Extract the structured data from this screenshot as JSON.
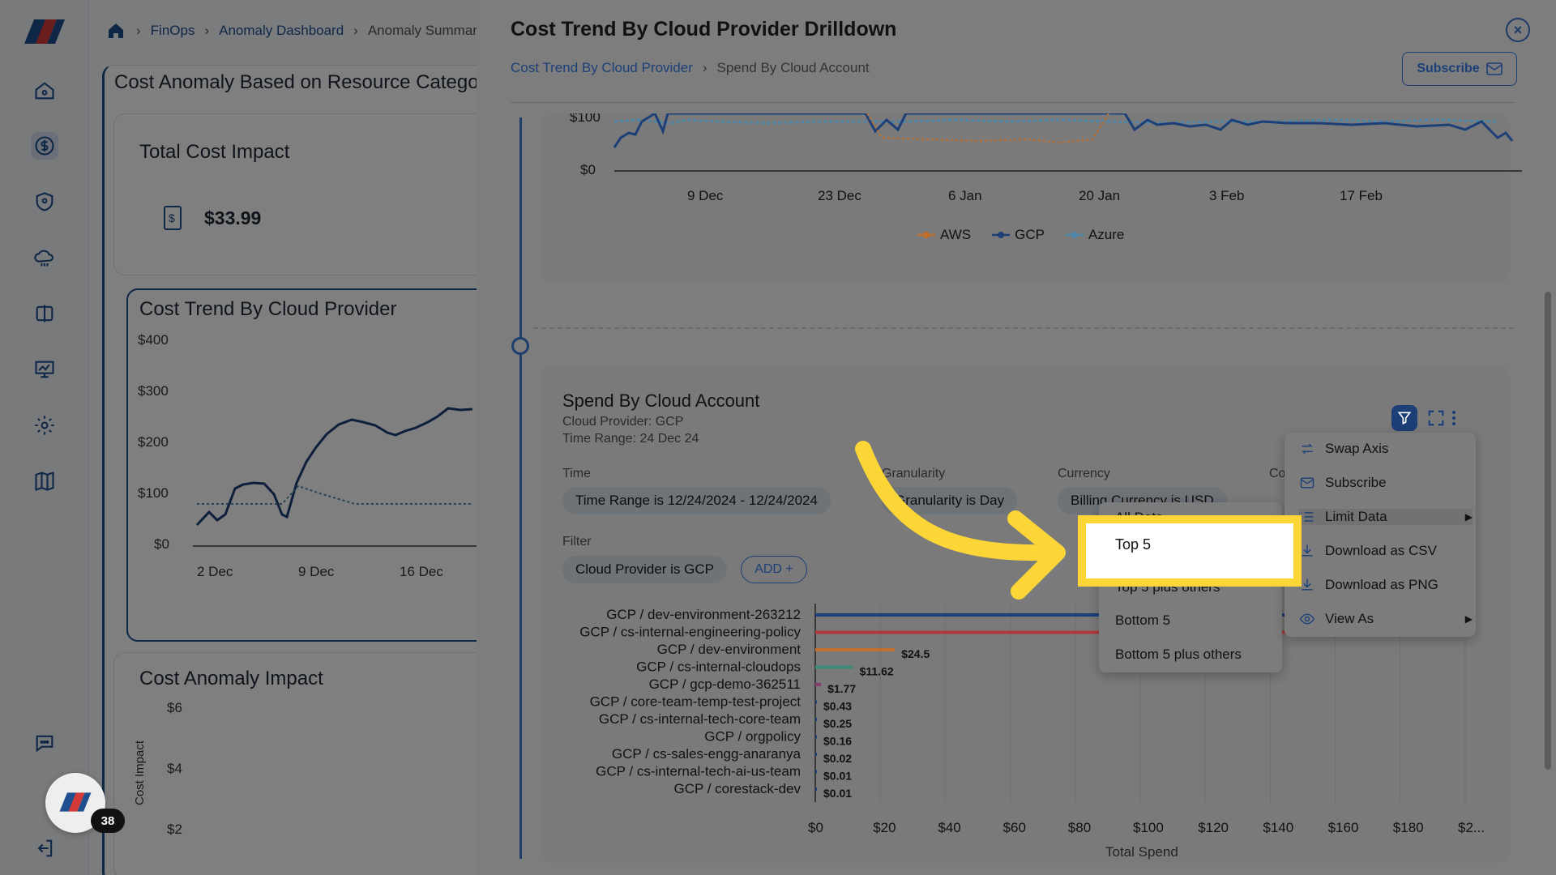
{
  "breadcrumb": {
    "items": [
      "FinOps",
      "Anomaly Dashboard"
    ],
    "current": "Anomaly Summary"
  },
  "background": {
    "section_title": "Cost Anomaly Based on Resource Catego",
    "total_cost": {
      "title": "Total Cost Impact",
      "value": "$33.99"
    },
    "trend_card": {
      "title": "Cost Trend By Cloud Provider",
      "y_ticks": [
        "$400",
        "$300",
        "$200",
        "$100",
        "$0"
      ],
      "x_ticks": [
        "2 Dec",
        "9 Dec",
        "16 Dec"
      ]
    },
    "anomaly_card": {
      "title": "Cost Anomaly Impact",
      "y_ticks": [
        "$6",
        "$4",
        "$2"
      ],
      "y_label": "Cost Impact"
    }
  },
  "drawer": {
    "title": "Cost Trend By Cloud Provider Drilldown",
    "crumb_link": "Cost Trend By Cloud Provider",
    "crumb_current": "Spend By Cloud Account",
    "subscribe_label": "Subscribe",
    "top_chart": {
      "y_ticks": [
        "$100",
        "$0"
      ],
      "x_ticks": [
        "9 Dec",
        "23 Dec",
        "6 Jan",
        "20 Jan",
        "3 Feb",
        "17 Feb"
      ],
      "legend": [
        {
          "name": "AWS",
          "color": "#c0702c"
        },
        {
          "name": "GCP",
          "color": "#1c3f78"
        },
        {
          "name": "Azure",
          "color": "#4b86a8"
        }
      ]
    },
    "spend": {
      "title": "Spend By Cloud Account",
      "provider_label": "Cloud Provider:",
      "provider_value": "GCP",
      "range_label": "Time Range:",
      "range_value": "24 Dec 24",
      "filters": {
        "time_label": "Time",
        "time_chip": "Time Range is 12/24/2024 - 12/24/2024",
        "granularity_label": "Granularity",
        "granularity_chip": "Granularity is Day",
        "currency_label": "Currency",
        "currency_chip": "Billing Currency is USD",
        "co_label": "Co",
        "filter_label": "Filter",
        "provider_chip": "Cloud Provider is GCP",
        "add_label": "ADD +"
      }
    },
    "context_menu": [
      {
        "label": "Swap Axis",
        "icon": "swap-icon"
      },
      {
        "label": "Subscribe",
        "icon": "mail-icon"
      },
      {
        "label": "Limit Data",
        "icon": "list-icon",
        "submenu": true
      },
      {
        "label": "Download as CSV",
        "icon": "download-icon"
      },
      {
        "label": "Download as PNG",
        "icon": "download-icon"
      },
      {
        "label": "View As",
        "icon": "eye-icon",
        "submenu": true
      }
    ],
    "limit_submenu": [
      "All Data",
      "Top 5",
      "Top 5 plus others",
      "Bottom 5",
      "Bottom 5 plus others"
    ],
    "highlighted_option": "Top 5"
  },
  "chart_data": {
    "type": "bar",
    "orientation": "horizontal",
    "categories": [
      "GCP / dev-environment-263212",
      "GCP / cs-internal-engineering-policy",
      "GCP / dev-environment",
      "GCP / cs-internal-cloudops",
      "GCP / gcp-demo-362511",
      "GCP / core-team-temp-test-project",
      "GCP / cs-internal-tech-core-team",
      "GCP / orgpolicy",
      "GCP / cs-sales-engg-anaranya",
      "GCP / cs-internal-tech-ai-us-team",
      "GCP / corestack-dev"
    ],
    "values": [
      200,
      200,
      24.5,
      11.62,
      1.77,
      0.43,
      0.25,
      0.16,
      0.02,
      0.01,
      0.01
    ],
    "data_labels": [
      "",
      "",
      "$24.5",
      "$11.62",
      "$1.77",
      "$0.43",
      "$0.25",
      "$0.16",
      "$0.02",
      "$0.01",
      "$0.01"
    ],
    "bar_colors": [
      "#1c3f78",
      "#b03a3a",
      "#c0702c",
      "#3d8a7a",
      "#8a3a6b",
      "#1c3f78",
      "#1c3f78",
      "#1c3f78",
      "#1c3f78",
      "#1c3f78",
      "#1c3f78"
    ],
    "x_ticks": [
      "$0",
      "$20",
      "$40",
      "$60",
      "$80",
      "$100",
      "$120",
      "$140",
      "$160",
      "$180",
      "$2..."
    ],
    "xlabel": "Total Spend",
    "xlim": [
      0,
      200
    ]
  },
  "fab": {
    "badge": "38"
  }
}
